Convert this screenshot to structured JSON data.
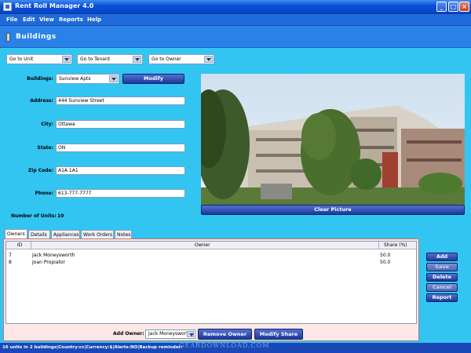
{
  "window": {
    "title": "Rent Roll Manager 4.0",
    "minimize": "_",
    "maximize": "□",
    "close": "×"
  },
  "menu": [
    "File",
    "Edit",
    "View",
    "Reports",
    "Help"
  ],
  "header": {
    "title": "Buildings"
  },
  "nav": {
    "goto_unit": "Go to Unit",
    "goto_tenant": "Go to Tenant",
    "goto_owner": "Go to Owner"
  },
  "form": {
    "buildings_label": "Buildings:",
    "buildings_value": "Sunview Apts",
    "modify_label": "Modify",
    "address_label": "Address:",
    "address_value": "444 Sunview Street",
    "city_label": "City:",
    "city_value": "Ottawa",
    "state_label": "State:",
    "state_value": "ON",
    "zip_label": "Zip Code:",
    "zip_value": "A1A 1A1",
    "phone_label": "Phone:",
    "phone_value": "613-777-7777",
    "units_label": "Number of Units:",
    "units_value": "10"
  },
  "picture": {
    "clear_label": "Clear Picture"
  },
  "tabs": [
    "Owners",
    "Details",
    "Appliances",
    "Work Orders",
    "Notes"
  ],
  "owners_table": {
    "columns": [
      "ID",
      "Owner",
      "Share (%)"
    ],
    "rows": [
      {
        "id": "7",
        "owner": "Jack Moneysworth",
        "share": "50.0"
      },
      {
        "id": "8",
        "owner": "Joan Propiator",
        "share": "50.0"
      }
    ]
  },
  "owner_actions": {
    "add_owner_label": "Add Owner:",
    "add_owner_value": "Jack Moneysworth",
    "remove_label": "Remove Owner",
    "modify_share_label": "Modify Share"
  },
  "side_buttons": {
    "add": "Add",
    "save": "Save",
    "delete": "Delete",
    "cancel": "Cancel",
    "report": "Report"
  },
  "statusbar": {
    "text": "16 units in 2 buildings|Country:cc|Currency:$|Alerts:NO|Backup reminder:"
  },
  "watermark": "GEARDOWNLOAD.COM",
  "colors": {
    "background": "#33c5f2",
    "header": "#2a82e8",
    "panel": "#fde7e7",
    "button": "#1a3a9c"
  }
}
